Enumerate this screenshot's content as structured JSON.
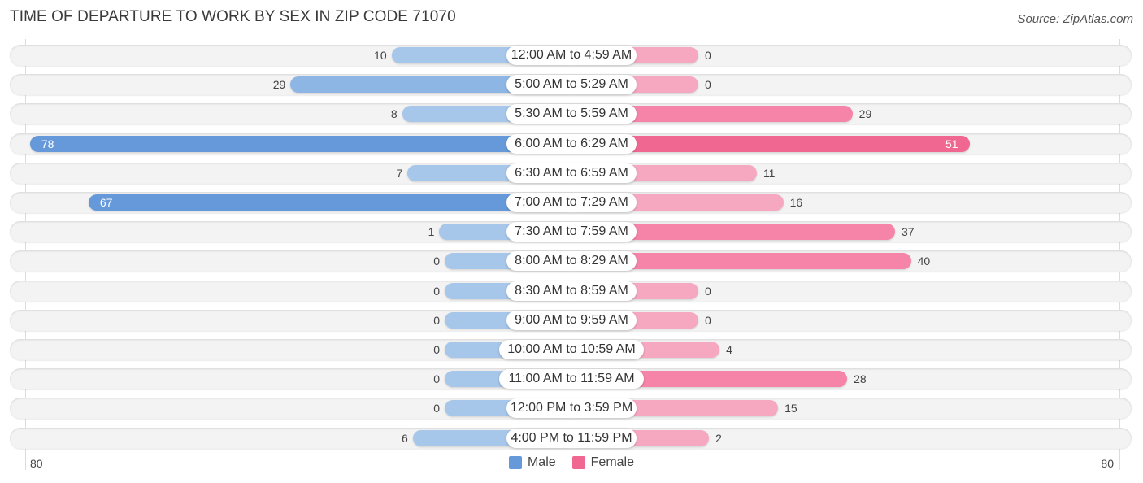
{
  "title": "TIME OF DEPARTURE TO WORK BY SEX IN ZIP CODE 71070",
  "source": "Source: ZipAtlas.com",
  "colors": {
    "male_strong": "#6699d9",
    "male_light": "#a6c6ea",
    "female_strong": "#f06792",
    "female_light": "#f7a8c1"
  },
  "chart_data": {
    "type": "bar",
    "orientation": "diverging-horizontal",
    "title": "TIME OF DEPARTURE TO WORK BY SEX IN ZIP CODE 71070",
    "categories": [
      "12:00 AM to 4:59 AM",
      "5:00 AM to 5:29 AM",
      "5:30 AM to 5:59 AM",
      "6:00 AM to 6:29 AM",
      "6:30 AM to 6:59 AM",
      "7:00 AM to 7:29 AM",
      "7:30 AM to 7:59 AM",
      "8:00 AM to 8:29 AM",
      "8:30 AM to 8:59 AM",
      "9:00 AM to 9:59 AM",
      "10:00 AM to 10:59 AM",
      "11:00 AM to 11:59 AM",
      "12:00 PM to 3:59 PM",
      "4:00 PM to 11:59 PM"
    ],
    "series": [
      {
        "name": "Male",
        "values": [
          10,
          29,
          8,
          78,
          7,
          67,
          1,
          0,
          0,
          0,
          0,
          0,
          0,
          6
        ]
      },
      {
        "name": "Female",
        "values": [
          0,
          0,
          29,
          51,
          11,
          16,
          37,
          40,
          0,
          0,
          4,
          28,
          15,
          2
        ]
      }
    ],
    "axis": {
      "left_label": "80",
      "right_label": "80",
      "range": [
        -80,
        80
      ]
    },
    "legend": {
      "position": "bottom-center",
      "entries": [
        "Male",
        "Female"
      ]
    },
    "grid": false
  }
}
